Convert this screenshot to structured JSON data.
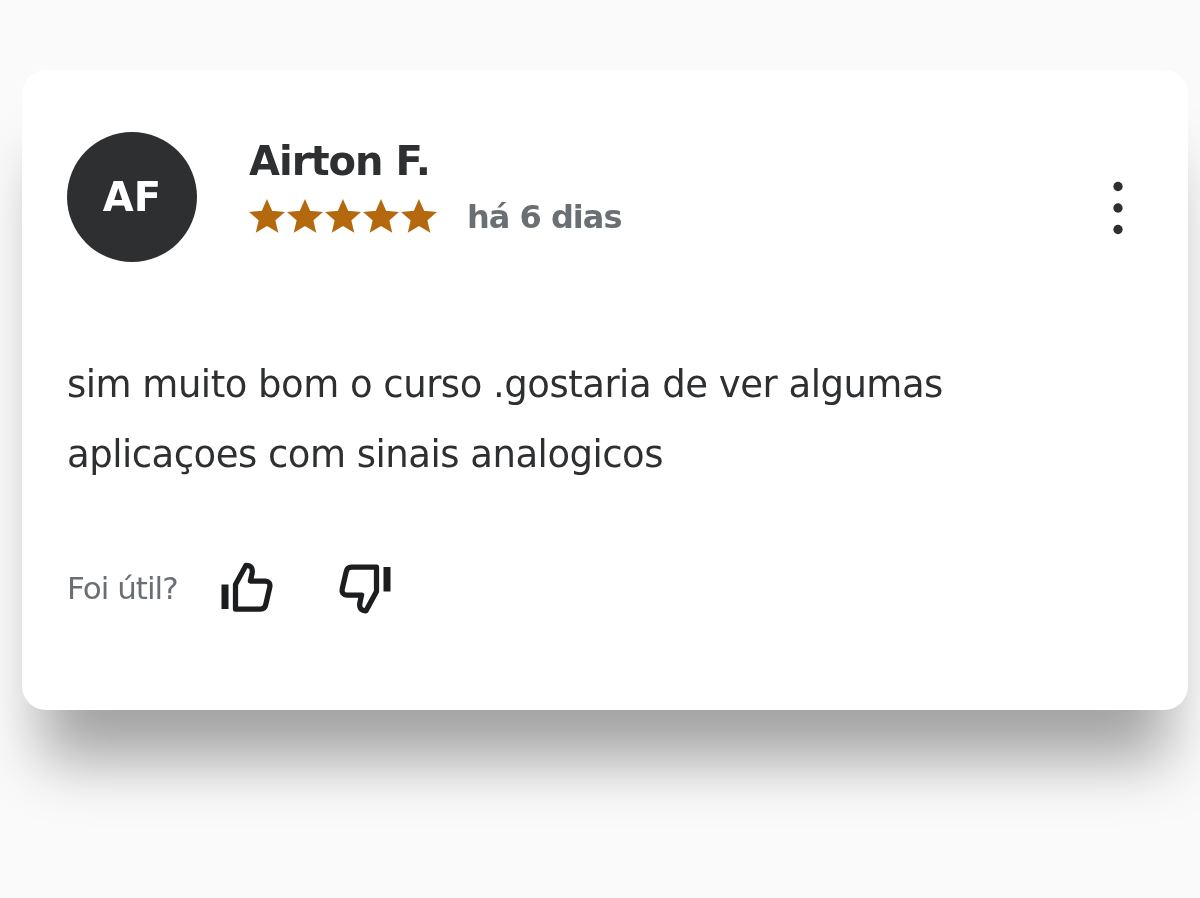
{
  "review": {
    "avatar_initials": "AF",
    "name": "Airton F.",
    "stars": 5,
    "time": "há 6 dias",
    "text": "sim muito bom o curso .gostaria de ver algumas aplicaçoes com sinais analogicos",
    "helpful_label": "Foi útil?"
  }
}
